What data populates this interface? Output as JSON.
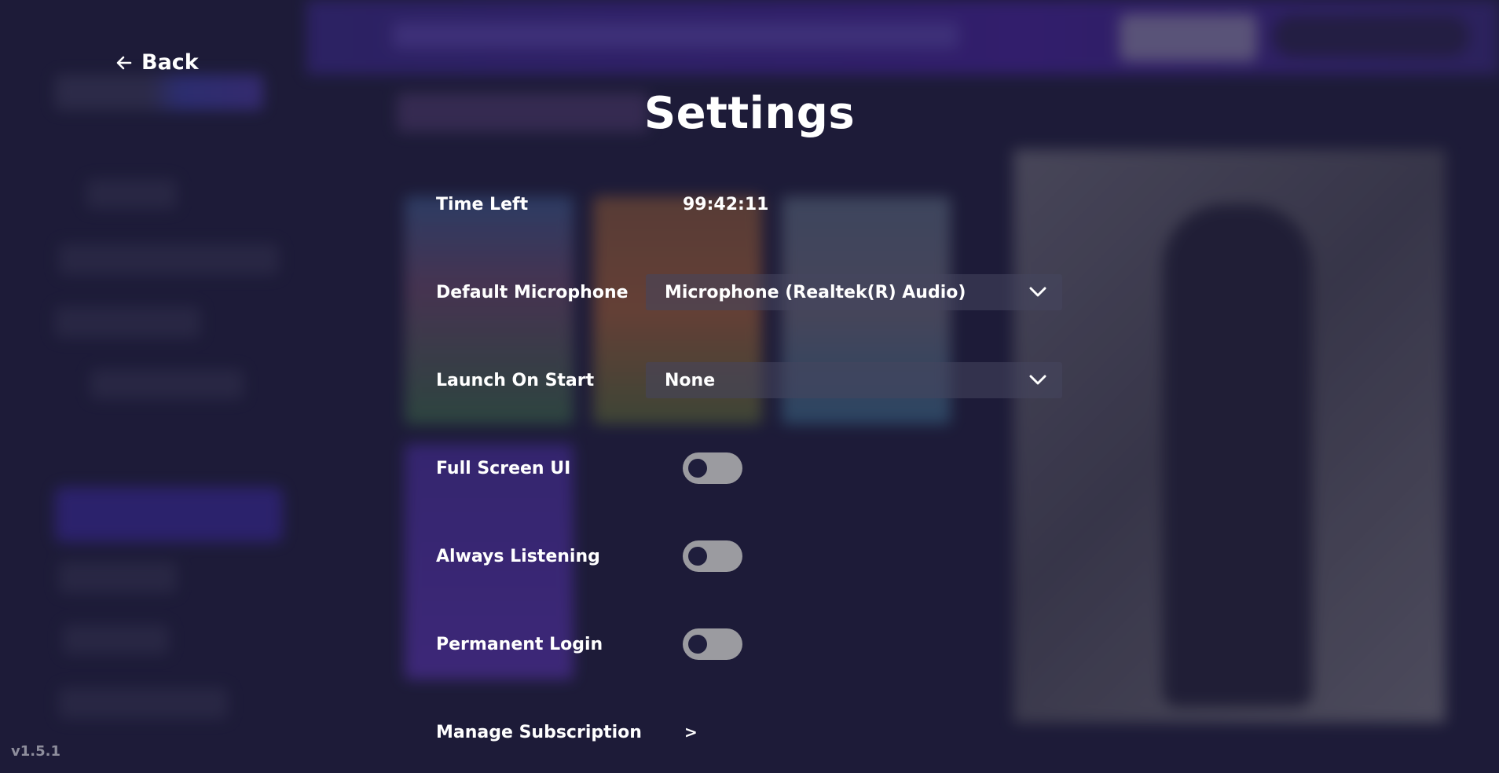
{
  "nav": {
    "back_label": "Back"
  },
  "page": {
    "title": "Settings"
  },
  "settings": {
    "time_left": {
      "label": "Time Left",
      "value": "99:42:11"
    },
    "default_microphone": {
      "label": "Default Microphone",
      "selected": "Microphone (Realtek(R) Audio)"
    },
    "launch_on_start": {
      "label": "Launch On Start",
      "selected": "None"
    },
    "full_screen_ui": {
      "label": "Full Screen UI",
      "enabled": false
    },
    "always_listening": {
      "label": "Always Listening",
      "enabled": false
    },
    "permanent_login": {
      "label": "Permanent Login",
      "enabled": false
    },
    "manage_subscription": {
      "label": "Manage Subscription",
      "arrow": ">"
    }
  },
  "footer": {
    "version": "v1.5.1"
  },
  "icons": {
    "back": "arrow-left-icon",
    "select": "chevron-down-icon",
    "subscription": "chevron-right-icon"
  },
  "colors": {
    "background": "#1f1e3c",
    "accent": "#45249a",
    "toggle_off": "#9b9ba0",
    "text": "#ffffff",
    "version_text": "#8e8e9c"
  }
}
